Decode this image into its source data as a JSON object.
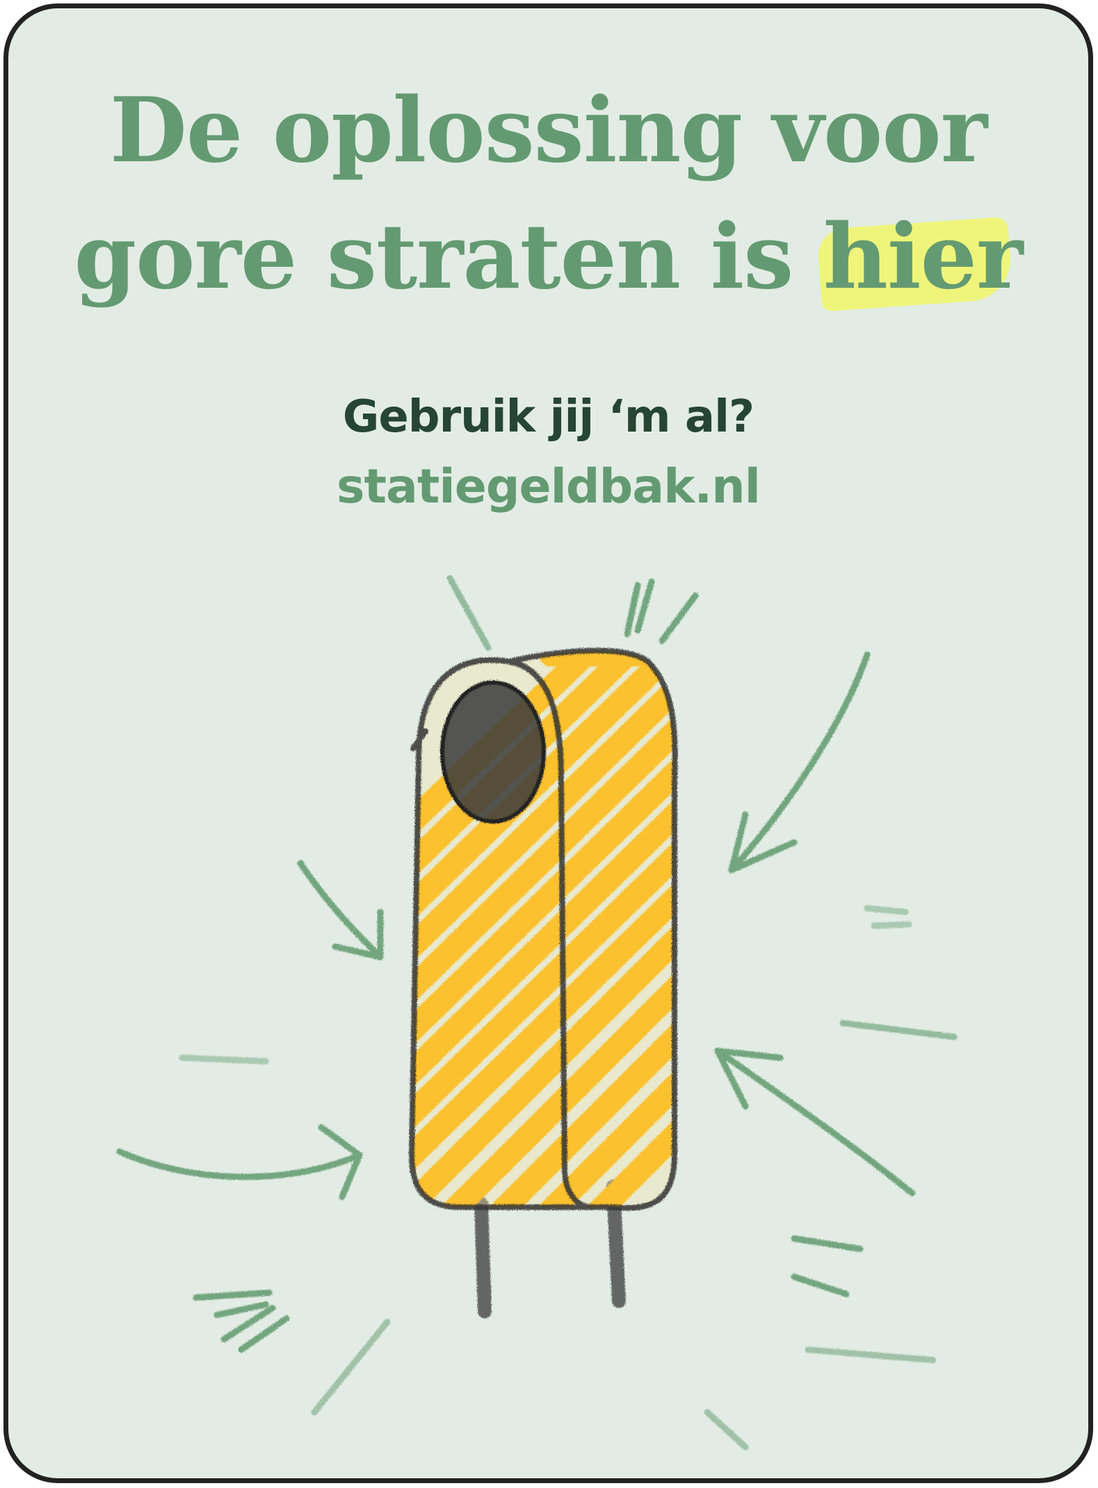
{
  "poster": {
    "headline_line1": "De oplossing voor",
    "headline_line2_prefix": "gore straten is ",
    "headline_highlight": "hier",
    "question": "Gebruik jij ‘m al?",
    "website": "statiegeldbak.nl"
  },
  "illustration": {
    "subject": "deposit-bin",
    "bin_color": "#fbc12e",
    "outline_color": "#333333",
    "arrow_color": "#5f9a6d"
  },
  "colors": {
    "background": "#e2ece4",
    "headline": "#649a72",
    "question": "#264532",
    "highlight": "#eef574",
    "border": "#222222"
  }
}
